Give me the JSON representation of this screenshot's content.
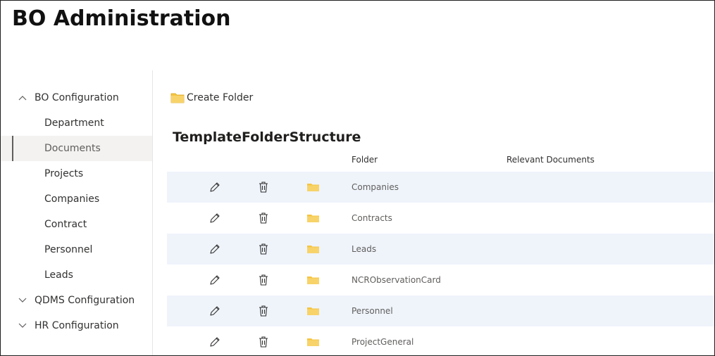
{
  "app": {
    "title": "BO Administration"
  },
  "sidebar": {
    "groups": [
      {
        "label": "BO Configuration",
        "expanded": true,
        "icon": "chevron-up-icon"
      },
      {
        "label": "QDMS Configuration",
        "expanded": false,
        "icon": "chevron-down-icon"
      },
      {
        "label": "HR Configuration",
        "expanded": false,
        "icon": "chevron-down-icon"
      }
    ],
    "items": [
      {
        "label": "Department",
        "selected": false
      },
      {
        "label": "Documents",
        "selected": true
      },
      {
        "label": "Projects",
        "selected": false
      },
      {
        "label": "Companies",
        "selected": false
      },
      {
        "label": "Contract",
        "selected": false
      },
      {
        "label": "Personnel",
        "selected": false
      },
      {
        "label": "Leads",
        "selected": false
      }
    ]
  },
  "toolbar": {
    "create_folder_label": "Create Folder",
    "icon": "folder-icon"
  },
  "main": {
    "title": "TemplateFolderStructure",
    "columns": {
      "folder": "Folder",
      "relevant_documents": "Relevant Documents"
    },
    "rows": [
      {
        "folder": "Companies",
        "relevant_documents": ""
      },
      {
        "folder": "Contracts",
        "relevant_documents": ""
      },
      {
        "folder": "Leads",
        "relevant_documents": ""
      },
      {
        "folder": "NCRObservationCard",
        "relevant_documents": ""
      },
      {
        "folder": "Personnel",
        "relevant_documents": ""
      },
      {
        "folder": "ProjectGeneral",
        "relevant_documents": ""
      }
    ],
    "row_icons": [
      "edit-pencil-icon",
      "delete-trash-icon",
      "folder-icon"
    ]
  },
  "colors": {
    "alt_row": "#eff4fb",
    "selected_nav": "#f3f2f1",
    "folder_yellow": "#f5c542"
  }
}
